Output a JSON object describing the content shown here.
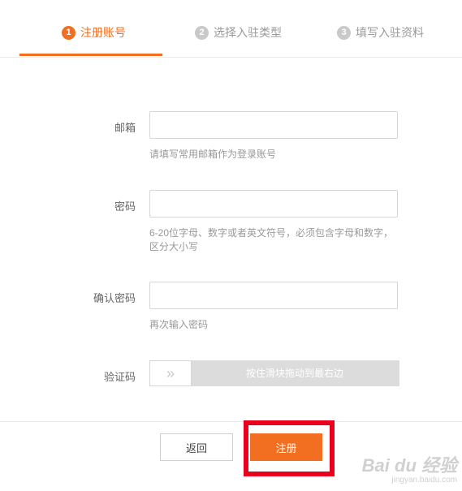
{
  "steps": [
    {
      "num": "1",
      "label": "注册账号",
      "state": "active"
    },
    {
      "num": "2",
      "label": "选择入驻类型",
      "state": "inactive"
    },
    {
      "num": "3",
      "label": "填写入驻资料",
      "state": "inactive"
    }
  ],
  "form": {
    "email": {
      "label": "邮箱",
      "value": "",
      "hint": "请填写常用邮箱作为登录账号"
    },
    "password": {
      "label": "密码",
      "value": "",
      "hint": "6-20位字母、数字或者英文符号，必须包含字母和数字，区分大小写"
    },
    "confirm": {
      "label": "确认密码",
      "value": "",
      "hint": "再次输入密码"
    },
    "captcha": {
      "label": "验证码",
      "slider_text": "按住滑块拖动到最右边",
      "handle_icon": "double-chevron-right-icon"
    }
  },
  "buttons": {
    "back": "返回",
    "register": "注册"
  },
  "watermark": {
    "logo": "Bai du 经验",
    "url": "jingyan.baidu.com"
  },
  "colors": {
    "accent": "#f26f21",
    "highlight": "#e8001e",
    "inactive": "#c9c9c9"
  }
}
